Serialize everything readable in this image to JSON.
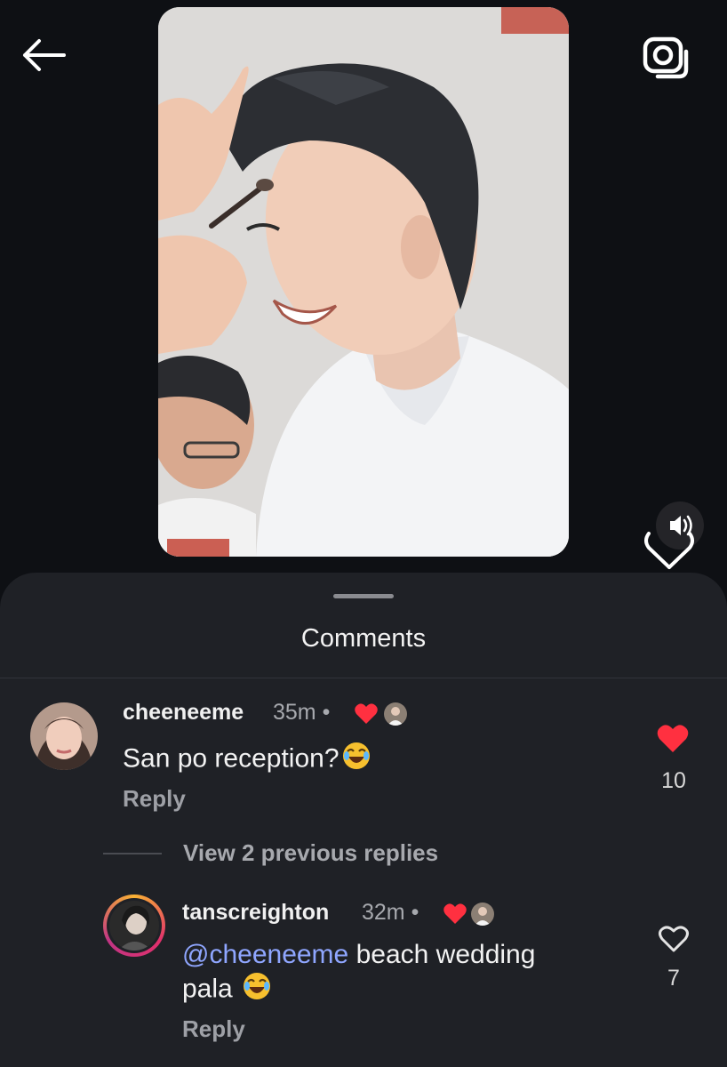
{
  "header": {
    "back_icon": "arrow-left-icon",
    "camera_icon": "camera-icon"
  },
  "post": {
    "sound_icon": "speaker-icon",
    "like_icon": "heart-outline-icon"
  },
  "sheet": {
    "title": "Comments"
  },
  "comments": [
    {
      "username": "cheeneeme",
      "time": "35m",
      "text": "San po reception?",
      "emoji": "😂",
      "reply_label": "Reply",
      "likes": "10",
      "liked": true
    }
  ],
  "view_replies_label": "View 2 previous replies",
  "reply": {
    "username": "tanscreighton",
    "time": "32m",
    "mention": "@cheeneeme",
    "text_line1": " beach wedding",
    "text_line2": "pala",
    "emoji": "😂",
    "reply_label": "Reply",
    "likes": "7",
    "liked": false
  },
  "colors": {
    "like_red": "#ff3040",
    "mention_blue": "#8fa6ff",
    "background": "#0e1014",
    "sheet": "#1f2126"
  }
}
